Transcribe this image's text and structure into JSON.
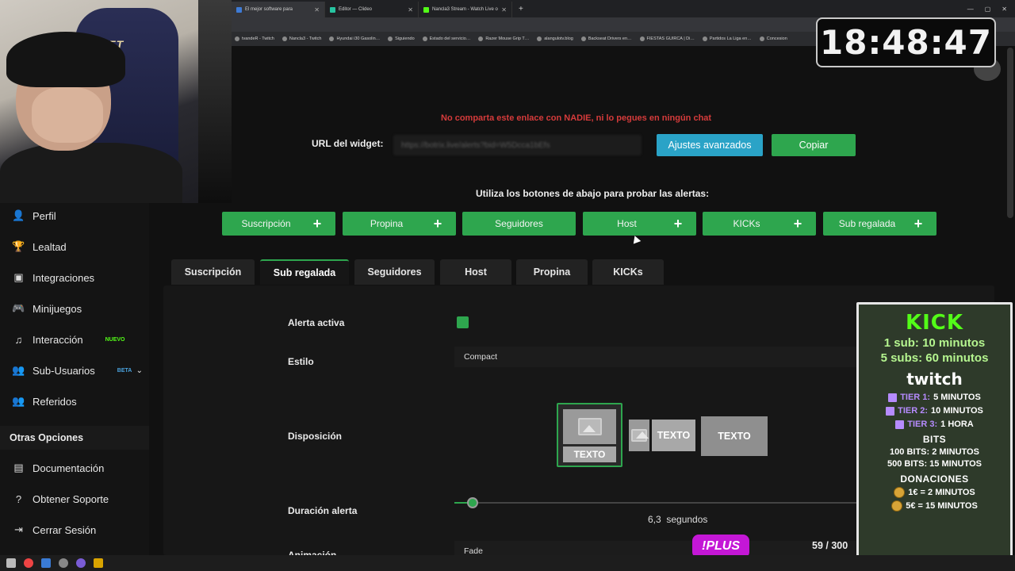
{
  "browser": {
    "tabs": [
      {
        "label": "El mejor software para",
        "active": true
      },
      {
        "label": "Editor — Clideo",
        "active": false
      },
      {
        "label": "Nancla3 Stream - Watch Live o",
        "active": false
      }
    ],
    "bookmarks": [
      "tvandeR - Twitch",
      "Nancla3 - Twitch",
      "Hyundai i30 Gasolin…",
      "Siguiendo",
      "Estado del servicio…",
      "Razer Mouse Grip T…",
      "alangulotv.blog",
      "Backseat Drivers en…",
      "FIESTAS GUIRCA | Di…",
      "Partidos La Liga en…",
      "Concesion"
    ]
  },
  "clock": "18:48:47",
  "sidebar": {
    "items": [
      {
        "label": "Perfil",
        "icon": "user-icon"
      },
      {
        "label": "Lealtad",
        "icon": "trophy-icon"
      },
      {
        "label": "Integraciones",
        "icon": "plug-icon"
      },
      {
        "label": "Minijuegos",
        "icon": "gamepad-icon"
      },
      {
        "label": "Interacción",
        "icon": "music-icon",
        "tag": "NUEVO"
      },
      {
        "label": "Sub-Usuarios",
        "icon": "users-icon",
        "tag": "BETA"
      },
      {
        "label": "Referidos",
        "icon": "group-icon"
      }
    ],
    "section": "Otras Opciones",
    "other": [
      {
        "label": "Documentación",
        "icon": "book-icon"
      },
      {
        "label": "Obtener Soporte",
        "icon": "help-icon"
      },
      {
        "label": "Cerrar Sesión",
        "icon": "logout-icon"
      }
    ]
  },
  "main": {
    "warning": "No comparta este enlace con NADIE, ni lo pegues en ningún chat",
    "url_label": "URL del widget:",
    "url_value": "https://botrix.live/alerts?bid=W5Dcca1bEfs",
    "advanced_button": "Ajustes avanzados",
    "copy_button": "Copiar",
    "hint": "Utiliza los botones de abajo para probar las alertas:",
    "test_buttons": [
      "Suscripción",
      "Propina",
      "Seguidores",
      "Host",
      "KICKs",
      "Sub regalada"
    ],
    "tabs": [
      "Suscripción",
      "Sub regalada",
      "Seguidores",
      "Host",
      "Propina",
      "KICKs"
    ],
    "active_tab": "Sub regalada",
    "fields": {
      "alert_active": "Alerta activa",
      "style": "Estilo",
      "style_value": "Compact",
      "layout": "Disposición",
      "layout_text": "TEXTO",
      "duration": "Duración alerta",
      "duration_value": "6,3",
      "duration_unit": "segundos",
      "duration_fraction": 0.045,
      "animation": "Animación",
      "animation_value": "Fade"
    }
  },
  "overlay": {
    "plus_badge": "!PLUS",
    "counter": "59 / 300"
  },
  "kick_panel": {
    "kick_logo": "KICK",
    "line1": "1 sub: 10 minutos",
    "line2": "5 subs: 60 minutos",
    "twitch_logo": "twitch",
    "tiers": [
      {
        "name": "TIER 1:",
        "value": "5 MINUTOS"
      },
      {
        "name": "TIER 2:",
        "value": "10 MINUTOS"
      },
      {
        "name": "TIER 3:",
        "value": "1 HORA"
      }
    ],
    "bits_title": "BITS",
    "bits": [
      "100 BITS: 2 MINUTOS",
      "500 BITS: 15 MINUTOS"
    ],
    "donations_title": "DONACIONES",
    "donations": [
      "1€ = 2 MINUTOS",
      "5€ = 15 MINUTOS"
    ]
  },
  "colors": {
    "accent_green": "#2ea64e",
    "kick_green": "#53fc18",
    "info_blue": "#2aa3c7",
    "warning_red": "#d63b3b",
    "plus_purple": "#c417d6"
  }
}
